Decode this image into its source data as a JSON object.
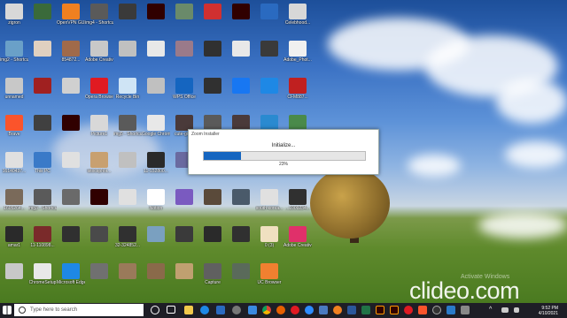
{
  "desktop_icons": [
    {
      "label": "zigron",
      "color": "#d8d8d8"
    },
    {
      "label": "img2 - Shortcut",
      "color": "#6aa0c8"
    },
    {
      "label": "unnamed",
      "color": "#c8c8c8"
    },
    {
      "label": "Brave",
      "color": "#fb542b"
    },
    {
      "label": "16140437...",
      "color": "#e0e0e0"
    },
    {
      "label": "1605264...",
      "color": "#7a6a5a"
    },
    {
      "label": "amar1",
      "color": "#2a2a2a"
    },
    {
      "label": "",
      "color": "#c8c8c8"
    },
    {
      "label": "",
      "color": "#3a6a3a"
    },
    {
      "label": "",
      "color": "#e0d0c0"
    },
    {
      "label": "",
      "color": "#a02020"
    },
    {
      "label": "",
      "color": "#404040"
    },
    {
      "label": "This PC",
      "color": "#3a7ac8"
    },
    {
      "label": "img3 - Shortcut",
      "color": "#5a5a5a"
    },
    {
      "label": "11-110898...",
      "color": "#7a2a2a"
    },
    {
      "label": "ChromeSetup",
      "color": "#e8e8e8"
    },
    {
      "label": "OpenVPN GUI",
      "color": "#f08020"
    },
    {
      "label": "854872...",
      "color": "#a06a4a"
    },
    {
      "label": "",
      "color": "#d0d0d0"
    },
    {
      "label": "",
      "color": "#300000"
    },
    {
      "label": "",
      "color": "#e0e0e0"
    },
    {
      "label": "",
      "color": "#6a6a6a"
    },
    {
      "label": "",
      "color": "#303030"
    },
    {
      "label": "Microsoft Edge",
      "color": "#1e88e5"
    },
    {
      "label": "img4 - Shortcut",
      "color": "#5a5a5a"
    },
    {
      "label": "Adobe Creative C...",
      "color": "#c8c8c8"
    },
    {
      "label": "Opera Browser",
      "color": "#e01a22"
    },
    {
      "label": "Picture1",
      "color": "#d8d8d8"
    },
    {
      "label": "istockphot...",
      "color": "#c8a070"
    },
    {
      "label": "",
      "color": "#300000"
    },
    {
      "label": "",
      "color": "#4a4a4a"
    },
    {
      "label": "",
      "color": "#707070"
    },
    {
      "label": "",
      "color": "#3a3a3a"
    },
    {
      "label": "",
      "color": "#c0c0c0"
    },
    {
      "label": "Recycle Bin",
      "color": "#cfe4f5"
    },
    {
      "label": "img5 - Shortcut",
      "color": "#5a5a5a"
    },
    {
      "label": "",
      "color": "#c0c0c0"
    },
    {
      "label": "",
      "color": "#e0e0e0"
    },
    {
      "label": "32-324852...",
      "color": "#303030"
    },
    {
      "label": "",
      "color": "#9a7a5a"
    },
    {
      "label": "",
      "color": "#300000"
    },
    {
      "label": "",
      "color": "#e8e8e8"
    },
    {
      "label": "",
      "color": "#c0c0c0"
    },
    {
      "label": "Google Chrome",
      "color": "#e8e8e8"
    },
    {
      "label": "11-152800...",
      "color": "#2a2a2a"
    },
    {
      "label": "Notion",
      "color": "#ffffff"
    },
    {
      "label": "",
      "color": "#7aa0c0"
    },
    {
      "label": "",
      "color": "#8a6a4a"
    },
    {
      "label": "",
      "color": "#6a8a6a"
    },
    {
      "label": "",
      "color": "#9a7a8a"
    },
    {
      "label": "WPS Office",
      "color": "#1565c0"
    },
    {
      "label": "cute-girl...",
      "color": "#4a3a3a"
    },
    {
      "label": "",
      "color": "#6a6aa0"
    },
    {
      "label": "",
      "color": "#7a5ac0"
    },
    {
      "label": "",
      "color": "#3a3a3a"
    },
    {
      "label": "",
      "color": "#c0a070"
    },
    {
      "label": "",
      "color": "#d03030"
    },
    {
      "label": "",
      "color": "#303030"
    },
    {
      "label": "",
      "color": "#303030"
    },
    {
      "label": "",
      "color": "#5a5a5a"
    },
    {
      "label": "",
      "color": "#3a3a3a"
    },
    {
      "label": "",
      "color": "#5a4a3a"
    },
    {
      "label": "",
      "color": "#2a2a2a"
    },
    {
      "label": "Capture",
      "color": "#606060"
    },
    {
      "label": "",
      "color": "#300000"
    },
    {
      "label": "",
      "color": "#e8e8e8"
    },
    {
      "label": "",
      "color": "#1877f2"
    },
    {
      "label": "",
      "color": "#4a3a3a"
    },
    {
      "label": "",
      "color": "#6a6a6a"
    },
    {
      "label": "",
      "color": "#4a5a6a"
    },
    {
      "label": "",
      "color": "#303030"
    },
    {
      "label": "",
      "color": "#5a6a5a"
    },
    {
      "label": "",
      "color": "#2a6ac0"
    },
    {
      "label": "",
      "color": "#3a3a3a"
    },
    {
      "label": "",
      "color": "#1e88e5"
    },
    {
      "label": "",
      "color": "#2a8ad0"
    },
    {
      "label": "img1 - Shortcut",
      "color": "#5a5a5a"
    },
    {
      "label": "south-korea...",
      "color": "#e0e0e0"
    },
    {
      "label": "0 (3)",
      "color": "#f0e0c0"
    },
    {
      "label": "UC Browser",
      "color": "#f08030"
    },
    {
      "label": "Celebhood...",
      "color": "#d8d8d8"
    },
    {
      "label": "Adobe_Phot...",
      "color": "#f0f0f0"
    },
    {
      "label": "CFM887...",
      "color": "#c02020"
    },
    {
      "label": "football-ga...",
      "color": "#4a8a4a"
    },
    {
      "label": "professiona...",
      "color": "#5a3a3a"
    },
    {
      "label": "...1009234...",
      "color": "#303030"
    },
    {
      "label": "Adobe Creative...",
      "color": "#e0306a"
    }
  ],
  "dialog": {
    "title": "Zoom Installer",
    "status": "Initialize...",
    "progress": 0.23,
    "percent_text": "23%"
  },
  "watermark": "clideo.com",
  "activate_text": "Activate Windows",
  "taskbar": {
    "search_placeholder": "Type here to search",
    "time": "9:52 PM",
    "date": "4/10/2021"
  }
}
